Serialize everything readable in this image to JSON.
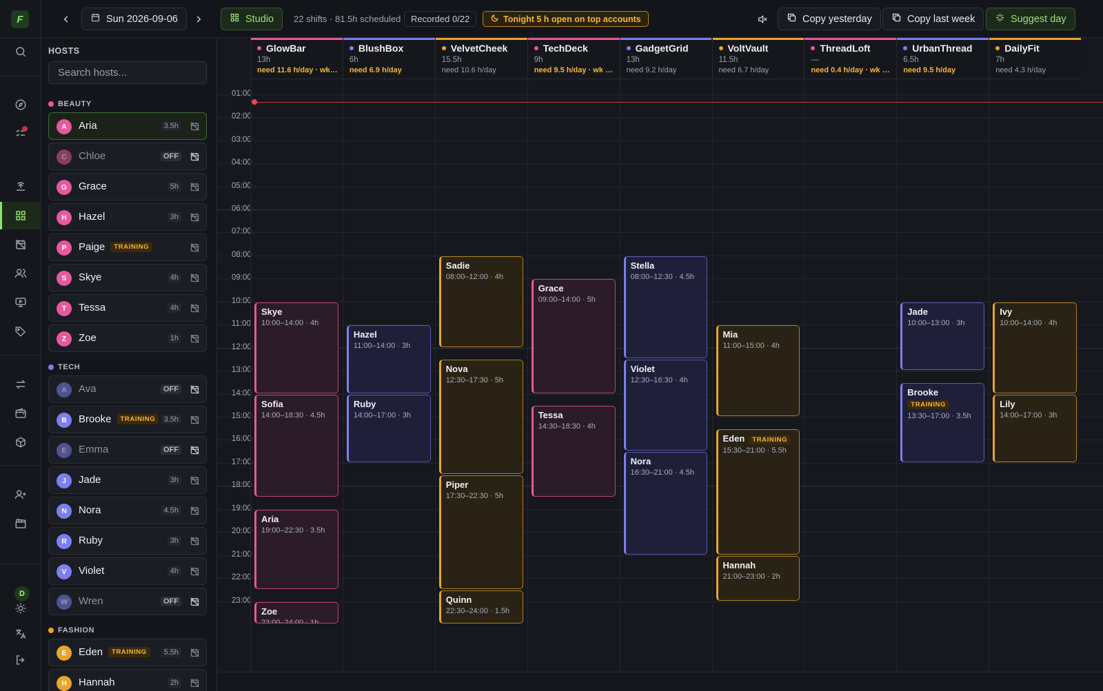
{
  "app": {
    "logo_letter": "F"
  },
  "toolbar": {
    "date": "Sun 2026-09-06",
    "studio_label": "Studio",
    "stats": "22 shifts · 81.5h scheduled",
    "recorded": "Recorded 0/22",
    "tonight": "Tonight 5 h open on top accounts",
    "copy_yesterday": "Copy yesterday",
    "copy_last_week": "Copy last week",
    "suggest_day": "Suggest day"
  },
  "rail": {
    "user_initial": "D",
    "icons": [
      "search-icon",
      "compass-icon",
      "checklist-icon",
      "broadcast-icon",
      "grid-icon",
      "calendar-off-icon",
      "users-icon",
      "monitor-icon",
      "tags-icon",
      "transfer-icon",
      "wallet-icon",
      "package-icon",
      "user-plus-icon",
      "clapper-icon",
      "sun-icon",
      "translate-icon",
      "logout-icon"
    ]
  },
  "sidebar": {
    "title": "HOSTS",
    "search_placeholder": "Search hosts...",
    "groups": [
      {
        "label": "BEAUTY",
        "color": "#e8589d",
        "hosts": [
          {
            "initial": "A",
            "name": "Aria",
            "hours": "3.5h",
            "selected": true
          },
          {
            "initial": "C",
            "name": "Chloe",
            "off": "OFF"
          },
          {
            "initial": "G",
            "name": "Grace",
            "hours": "5h"
          },
          {
            "initial": "H",
            "name": "Hazel",
            "hours": "3h"
          },
          {
            "initial": "P",
            "name": "Paige",
            "training": "TRAINING"
          },
          {
            "initial": "S",
            "name": "Skye",
            "hours": "4h"
          },
          {
            "initial": "T",
            "name": "Tessa",
            "hours": "4h"
          },
          {
            "initial": "Z",
            "name": "Zoe",
            "hours": "1h"
          }
        ]
      },
      {
        "label": "TECH",
        "color": "#7d7ff0",
        "hosts": [
          {
            "initial": "A",
            "name": "Ava",
            "off": "OFF"
          },
          {
            "initial": "B",
            "name": "Brooke",
            "training": "TRAINING",
            "hours": "3.5h"
          },
          {
            "initial": "E",
            "name": "Emma",
            "off": "OFF"
          },
          {
            "initial": "J",
            "name": "Jade",
            "hours": "3h"
          },
          {
            "initial": "N",
            "name": "Nora",
            "hours": "4.5h"
          },
          {
            "initial": "R",
            "name": "Ruby",
            "hours": "3h"
          },
          {
            "initial": "V",
            "name": "Violet",
            "hours": "4h"
          },
          {
            "initial": "W",
            "name": "Wren",
            "off": "OFF"
          }
        ]
      },
      {
        "label": "FASHION",
        "color": "#e9a52a",
        "hosts": [
          {
            "initial": "E",
            "name": "Eden",
            "training": "TRAINING",
            "hours": "5.5h"
          },
          {
            "initial": "H",
            "name": "Hannah",
            "hours": "2h"
          }
        ]
      }
    ]
  },
  "times": [
    "01:00",
    "02:00",
    "03:00",
    "04:00",
    "05:00",
    "06:00",
    "07:00",
    "08:00",
    "09:00",
    "10:00",
    "11:00",
    "12:00",
    "13:00",
    "14:00",
    "15:00",
    "16:00",
    "17:00",
    "18:00",
    "19:00",
    "20:00",
    "21:00",
    "22:00",
    "23:00"
  ],
  "now_hour": 1.33,
  "columns": [
    {
      "name": "GlowBar",
      "hours": "13h",
      "need": "need 11.6 h/day · wk 7…",
      "warn": true,
      "color": "#e8589d"
    },
    {
      "name": "BlushBox",
      "hours": "6h",
      "need": "need 6.9 h/day",
      "warn": true,
      "color": "#7d7ff0"
    },
    {
      "name": "VelvetCheek",
      "hours": "15.5h",
      "need": "need 10.6 h/day",
      "warn": false,
      "color": "#e9a52a"
    },
    {
      "name": "TechDeck",
      "hours": "9h",
      "need": "need 9.5 h/day · wk 67…",
      "warn": true,
      "color": "#e8589d"
    },
    {
      "name": "GadgetGrid",
      "hours": "13h",
      "need": "need 9.2 h/day",
      "warn": false,
      "color": "#7d7ff0"
    },
    {
      "name": "VoltVault",
      "hours": "11.5h",
      "need": "need 6.7 h/day",
      "warn": false,
      "color": "#e9a52a"
    },
    {
      "name": "ThreadLoft",
      "hours": "—",
      "need": "need 0.4 h/day · wk 0/…",
      "warn": true,
      "color": "#e8589d"
    },
    {
      "name": "UrbanThread",
      "hours": "6.5h",
      "need": "need 9.5 h/day",
      "warn": true,
      "color": "#7d7ff0"
    },
    {
      "name": "DailyFit",
      "hours": "7h",
      "need": "need 4.3 h/day",
      "warn": false,
      "color": "#e9a52a"
    }
  ],
  "shifts": [
    {
      "col": 0,
      "name": "Skye",
      "label": "10:00–14:00 · 4h",
      "start": 10,
      "end": 14,
      "tone": "pink"
    },
    {
      "col": 0,
      "name": "Sofia",
      "label": "14:00–18:30 · 4.5h",
      "start": 14,
      "end": 18.5,
      "tone": "pink"
    },
    {
      "col": 0,
      "name": "Aria",
      "label": "19:00–22:30 · 3.5h",
      "start": 19,
      "end": 22.5,
      "tone": "pink"
    },
    {
      "col": 0,
      "name": "Zoe",
      "label": "23:00–24:00 · 1h",
      "start": 23,
      "end": 24,
      "tone": "pink"
    },
    {
      "col": 1,
      "name": "Hazel",
      "label": "11:00–14:00 · 3h",
      "start": 11,
      "end": 14,
      "tone": "blue"
    },
    {
      "col": 1,
      "name": "Ruby",
      "label": "14:00–17:00 · 3h",
      "start": 14,
      "end": 17,
      "tone": "blue"
    },
    {
      "col": 2,
      "name": "Sadie",
      "label": "08:00–12:00 · 4h",
      "start": 8,
      "end": 12,
      "tone": "gold"
    },
    {
      "col": 2,
      "name": "Nova",
      "label": "12:30–17:30 · 5h",
      "start": 12.5,
      "end": 17.5,
      "tone": "gold"
    },
    {
      "col": 2,
      "name": "Piper",
      "label": "17:30–22:30 · 5h",
      "start": 17.5,
      "end": 22.5,
      "tone": "gold"
    },
    {
      "col": 2,
      "name": "Quinn",
      "label": "22:30–24:00 · 1.5h",
      "start": 22.5,
      "end": 24,
      "tone": "gold"
    },
    {
      "col": 3,
      "name": "Grace",
      "label": "09:00–14:00 · 5h",
      "start": 9,
      "end": 14,
      "tone": "pink"
    },
    {
      "col": 3,
      "name": "Tessa",
      "label": "14:30–18:30 · 4h",
      "start": 14.5,
      "end": 18.5,
      "tone": "pink"
    },
    {
      "col": 4,
      "name": "Stella",
      "label": "08:00–12:30 · 4.5h",
      "start": 8,
      "end": 12.5,
      "tone": "blue"
    },
    {
      "col": 4,
      "name": "Violet",
      "label": "12:30–16:30 · 4h",
      "start": 12.5,
      "end": 16.5,
      "tone": "blue"
    },
    {
      "col": 4,
      "name": "Nora",
      "label": "16:30–21:00 · 4.5h",
      "start": 16.5,
      "end": 21,
      "tone": "blue"
    },
    {
      "col": 5,
      "name": "Mia",
      "label": "11:00–15:00 · 4h",
      "start": 11,
      "end": 15,
      "tone": "gold"
    },
    {
      "col": 5,
      "name": "Eden",
      "training": "TRAINING",
      "label": "15:30–21:00 · 5.5h",
      "start": 15.5,
      "end": 21,
      "tone": "gold"
    },
    {
      "col": 5,
      "name": "Hannah",
      "label": "21:00–23:00 · 2h",
      "start": 21,
      "end": 23,
      "tone": "gold"
    },
    {
      "col": 7,
      "name": "Jade",
      "label": "10:00–13:00 · 3h",
      "start": 10,
      "end": 13,
      "tone": "blue"
    },
    {
      "col": 7,
      "name": "Brooke",
      "training": "TRAINING",
      "label": "13:30–17:00 · 3.5h",
      "start": 13.5,
      "end": 17,
      "tone": "blue"
    },
    {
      "col": 8,
      "name": "Ivy",
      "label": "10:00–14:00 · 4h",
      "start": 10,
      "end": 14,
      "tone": "gold"
    },
    {
      "col": 8,
      "name": "Lily",
      "label": "14:00–17:00 · 3h",
      "start": 14,
      "end": 17,
      "tone": "gold"
    }
  ]
}
